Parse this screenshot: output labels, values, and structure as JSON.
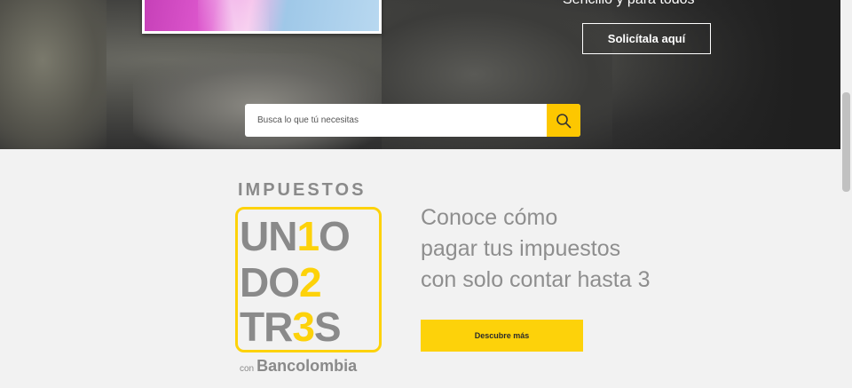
{
  "hero": {
    "tagline": "Sencillo y para todos",
    "cta_label": "Solicítala aquí",
    "search_placeholder": "Busca lo que tú necesitas",
    "search_icon": "search-icon",
    "accent_color": "#fdc700"
  },
  "promo": {
    "logo_title": "IMPUESTOS",
    "logo_row1_a": "UN",
    "logo_row1_b": "1",
    "logo_row1_c": "O",
    "logo_row2_a": "DO",
    "logo_row2_b": "2",
    "logo_row3_a": "TR",
    "logo_row3_b": "3",
    "logo_row3_c": "S",
    "logo_con": "con",
    "logo_brand": "Bancolombia",
    "headline_lines": [
      "Conoce cómo",
      "pagar tus impuestos",
      "con solo contar hasta 3"
    ],
    "cta_label": "Descubre más",
    "accent_color": "#fdd20a"
  }
}
